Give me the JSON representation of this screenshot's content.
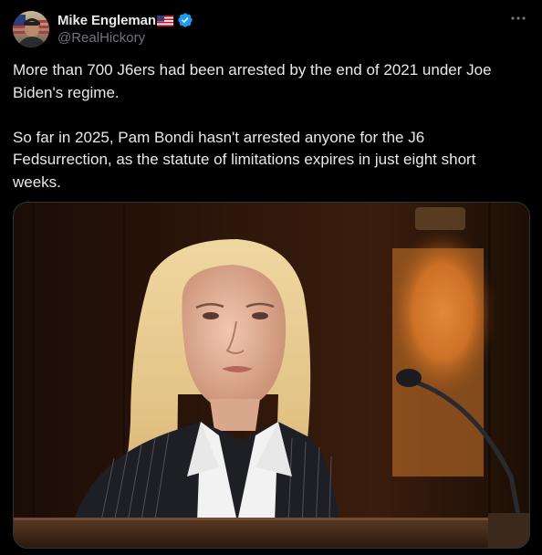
{
  "post": {
    "author": {
      "display_name": "Mike Engleman",
      "handle": "@RealHickory",
      "flag_icon": "us-flag-icon",
      "verified_icon": "verified-badge-icon",
      "verified_color": "#1d9bf0"
    },
    "more_icon": "more-options-icon",
    "text": "More than 700 J6ers had been arrested by the end of 2021 under Joe Biden's regime.\n\nSo far in 2025, Pam Bondi hasn't arrested anyone for the J6 Fedsurrection, as the statute of limitations expires in just eight short weeks.",
    "media": {
      "type": "photo"
    }
  },
  "colors": {
    "background": "#000000",
    "text_primary": "#e7e9ea",
    "text_secondary": "#71767b",
    "border": "#2f3336"
  }
}
